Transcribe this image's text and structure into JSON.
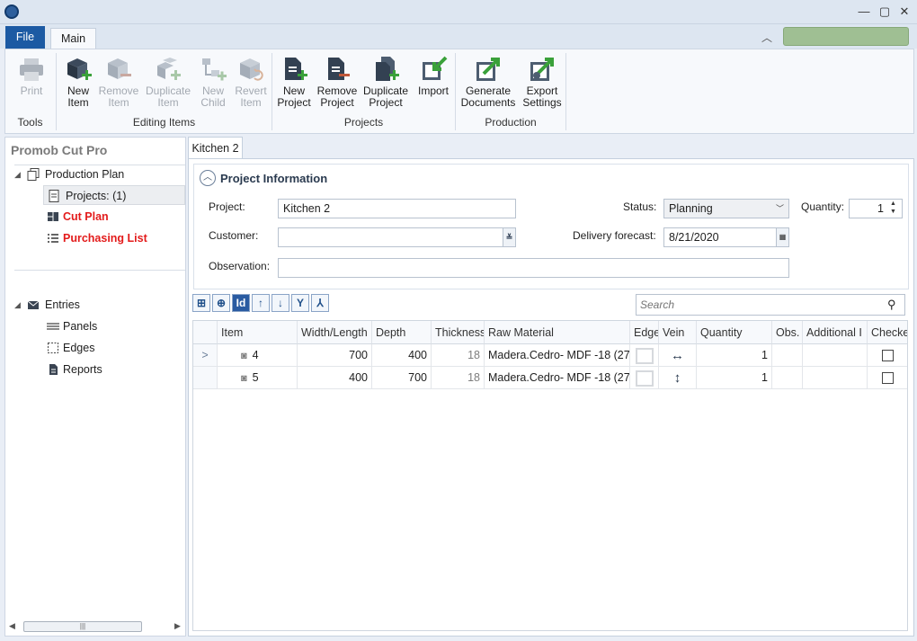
{
  "window": {
    "minimize": "—",
    "maximize": "▢",
    "close": "✕"
  },
  "ribbon_tabs": {
    "file": "File",
    "main": "Main"
  },
  "ribbon": {
    "print": {
      "line1": "Print",
      "line2": ""
    },
    "new_item": {
      "line1": "New",
      "line2": "Item"
    },
    "remove_item": {
      "line1": "Remove",
      "line2": "Item"
    },
    "duplicate_item": {
      "line1": "Duplicate",
      "line2": "Item"
    },
    "new_child": {
      "line1": "New",
      "line2": "Child"
    },
    "revert_item": {
      "line1": "Revert",
      "line2": "Item"
    },
    "new_project": {
      "line1": "New",
      "line2": "Project"
    },
    "remove_project": {
      "line1": "Remove",
      "line2": "Project"
    },
    "duplicate_project": {
      "line1": "Duplicate",
      "line2": "Project"
    },
    "import": {
      "line1": "Import",
      "line2": ""
    },
    "generate_documents": {
      "line1": "Generate",
      "line2": "Documents"
    },
    "export_settings": {
      "line1": "Export",
      "line2": "Settings"
    },
    "groups": {
      "tools": "Tools",
      "editing_items": "Editing Items",
      "projects": "Projects",
      "production": "Production"
    }
  },
  "sidebar": {
    "title": "Promob Cut Pro",
    "production_plan": "Production Plan",
    "projects": "Projects: (1)",
    "cut_plan": "Cut Plan",
    "purchasing_list": "Purchasing List",
    "entries": "Entries",
    "panels": "Panels",
    "edges": "Edges",
    "reports": "Reports"
  },
  "document_tab": "Kitchen 2",
  "project_info": {
    "header": "Project Information",
    "project_label": "Project:",
    "project_value": "Kitchen 2",
    "customer_label": "Customer:",
    "customer_value": "",
    "observation_label": "Observation:",
    "observation_value": "",
    "status_label": "Status:",
    "status_value": "Planning",
    "quantity_label": "Quantity:",
    "quantity_value": "1",
    "delivery_label": "Delivery forecast:",
    "delivery_value": "8/21/2020"
  },
  "search": {
    "placeholder": "Search"
  },
  "grid": {
    "columns": [
      "Item",
      "Width/Length",
      "Depth",
      "Thickness",
      "Raw Material",
      "Edge",
      "Vein",
      "Quantity",
      "Obs.",
      "Additional I",
      "Checke"
    ],
    "rows": [
      {
        "item": "4",
        "width": "700",
        "depth": "400",
        "thickness": "18",
        "material": "Madera.Cedro- MDF -18 (27:",
        "vein": "↔",
        "quantity": "1"
      },
      {
        "item": "5",
        "width": "400",
        "depth": "700",
        "thickness": "18",
        "material": "Madera.Cedro- MDF -18 (27:",
        "vein": "↕",
        "quantity": "1"
      }
    ]
  },
  "colors": {
    "accent": "#1c5aa3",
    "red_link": "#e31b1b",
    "green_add": "#3aa13a",
    "ribbon_bg": "#f7f9fc"
  }
}
